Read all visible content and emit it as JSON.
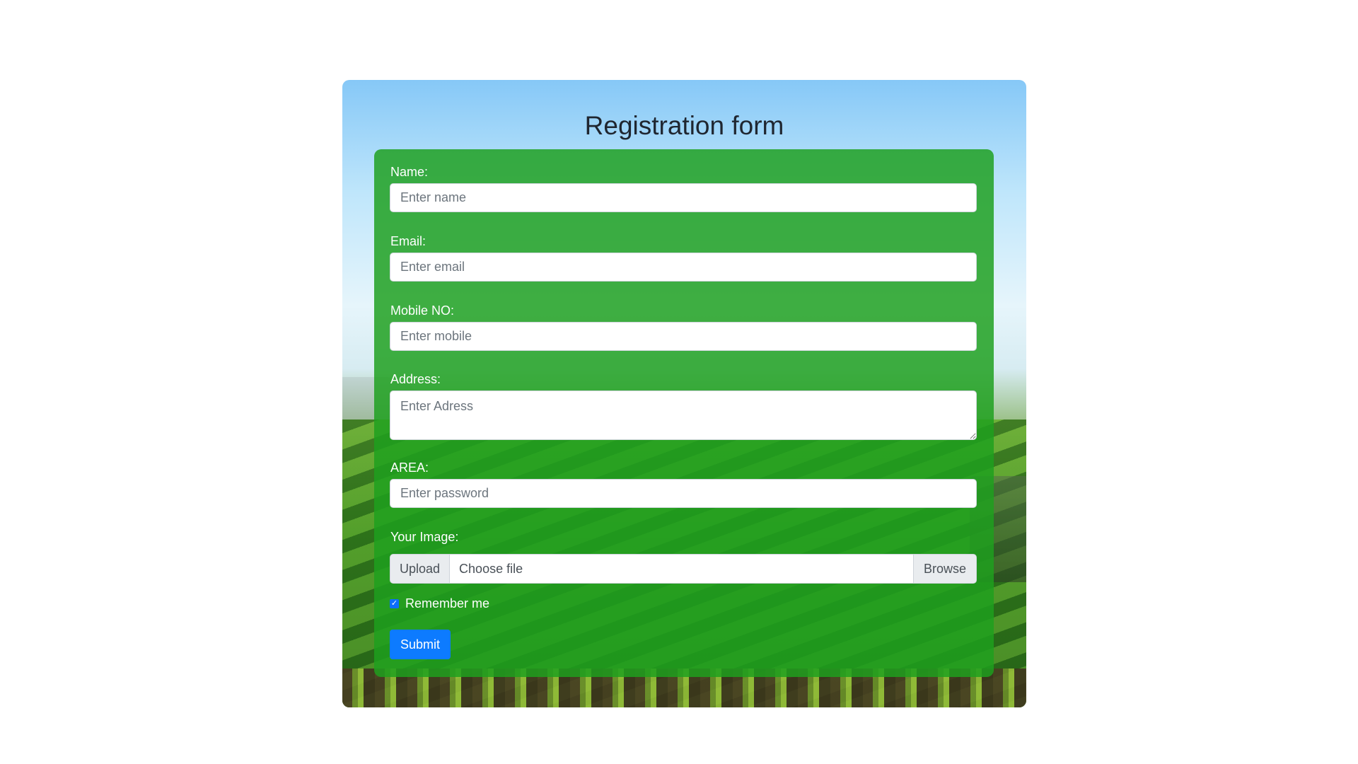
{
  "form": {
    "title": "Registration form",
    "name_label": "Name:",
    "name_placeholder": "Enter name",
    "email_label": "Email:",
    "email_placeholder": "Enter email",
    "mobile_label": "Mobile NO:",
    "mobile_placeholder": "Enter mobile",
    "address_label": "Address:",
    "address_placeholder": "Enter Adress",
    "area_label": "AREA:",
    "area_placeholder": "Enter password",
    "image_label": "Your Image:",
    "upload_label": "Upload",
    "file_placeholder": "Choose file",
    "browse_label": "Browse",
    "remember_label": "Remember me",
    "remember_checked": true,
    "submit_label": "Submit"
  },
  "colors": {
    "panel": "#1ea01e",
    "submit": "#0d7bff",
    "checkbox": "#0d6efd"
  },
  "icons": {
    "checkbox": "check-icon"
  }
}
